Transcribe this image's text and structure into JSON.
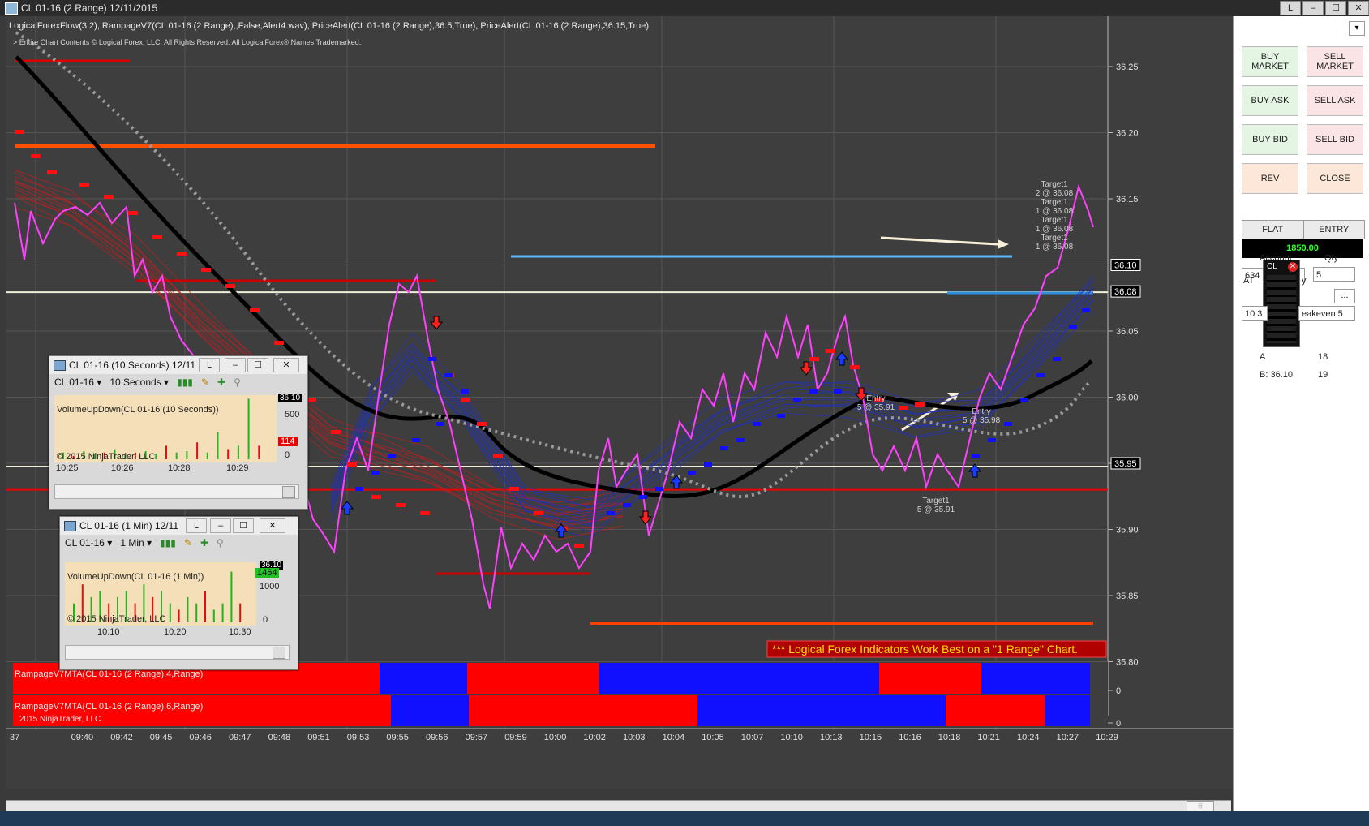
{
  "window": {
    "title": "CL 01-16 (2 Range)  12/11/2015",
    "buttons": [
      "L",
      "–",
      "☐",
      "✕"
    ]
  },
  "chart": {
    "indicators_line": "LogicalForexFlow(3,2),  RampageV7(CL 01-16 (2 Range),,False,Alert4.wav), PriceAlert(CL 01-16 (2 Range),36.5,True), PriceAlert(CL 01-16 (2 Range),36.15,True)",
    "copyright_line": "> Entire Chart Contents © Logical Forex, LLC. All Rights Reserved. All LogicalForex® Names Trademarked.",
    "promo_text": "*** Logical Forex Indicators Work Best on a \"1 Range\" Chart.",
    "price_axis": [
      "36.25",
      "36.20",
      "36.15",
      "36.10",
      "36.05",
      "36.00",
      "35.95",
      "35.90",
      "35.85",
      "35.80"
    ],
    "price_tags": [
      {
        "label": "36.10",
        "price": 36.1
      },
      {
        "label": "36.08",
        "price": 36.08
      },
      {
        "label": "35.95",
        "price": 35.95
      }
    ],
    "time_axis": [
      "37",
      "09:40",
      "09:42",
      "09:45",
      "09:46",
      "09:47",
      "09:48",
      "09:51",
      "09:53",
      "09:55",
      "09:56",
      "09:57",
      "09:59",
      "10:00",
      "10:02",
      "10:03",
      "10:04",
      "10:05",
      "10:07",
      "10:10",
      "10:13",
      "10:15",
      "10:16",
      "10:18",
      "10:21",
      "10:24",
      "10:27",
      "10:29"
    ],
    "annotations": [
      {
        "lines": [
          "Target1",
          "2 @ 36.08",
          "Target1",
          "1 @ 36.08",
          "Target1",
          "1 @ 36.08",
          "Target1",
          "1 @ 36.08"
        ]
      },
      {
        "lines": [
          "Entry",
          "5 @ 35.91"
        ]
      },
      {
        "lines": [
          "Entry",
          "5 @ 35.98"
        ]
      },
      {
        "lines": [
          "Target1",
          "5 @ 35.91"
        ]
      }
    ],
    "panel1_label": "RampageV7MTA(CL 01-16 (2 Range),4,Range)",
    "panel2_label": "RampageV7MTA(CL 01-16 (2 Range),6,Range)",
    "panel2_copyright": "2015 NinjaTrader, LLC",
    "panel_zero": "0",
    "colors": {
      "up": "#1010ff",
      "down": "#ff0000",
      "price": "#ff33ff",
      "bg": "#3e3e3e"
    }
  },
  "mini1": {
    "title": "CL 01-16 (10 Seconds)  12/11",
    "instrument": "CL 01-16",
    "interval": "10 Seconds",
    "indicator": "VolumeUpDown(CL 01-16 (10 Seconds))",
    "copyright": "© 2015 NinjaTrader, LLC",
    "axis": [
      "500",
      "0"
    ],
    "tag": "114",
    "top_tag": "36.10",
    "times": [
      "10:25",
      "10:26",
      "10:28",
      "10:29"
    ]
  },
  "mini2": {
    "title": "CL 01-16 (1 Min)  12/11",
    "instrument": "CL 01-16",
    "interval": "1 Min",
    "indicator": "VolumeUpDown(CL 01-16 (1 Min))",
    "copyright": "© 2015 NinjaTrader, LLC",
    "axis": [
      "1000",
      "0"
    ],
    "tag": "1464",
    "top_tag": "36.10",
    "times": [
      "10:10",
      "10:20",
      "10:30"
    ]
  },
  "order_panel": {
    "buy_market": "BUY MARKET",
    "sell_market": "SELL MARKET",
    "buy_ask": "BUY ASK",
    "sell_ask": "SELL ASK",
    "buy_bid": "BUY BID",
    "sell_bid": "SELL BID",
    "rev": "REV",
    "close": "CLOSE",
    "flat": "FLAT",
    "entry": "ENTRY",
    "pnl": "1850.00",
    "account_label": "Account",
    "account_value": "634",
    "qty_label": "Qty",
    "qty_value": "5",
    "atm_label": "AT",
    "atm_suffix": "y",
    "atm_button": "...",
    "strategy_prefix": "10 3",
    "strategy_value": "eakeven 5",
    "ask_label": "A",
    "ask_size": "18",
    "bid_label": "B: 36.10",
    "bid_size": "19",
    "ladder_label": "CL"
  },
  "scroll": {
    "right_button": "⦙⦙⦙"
  }
}
